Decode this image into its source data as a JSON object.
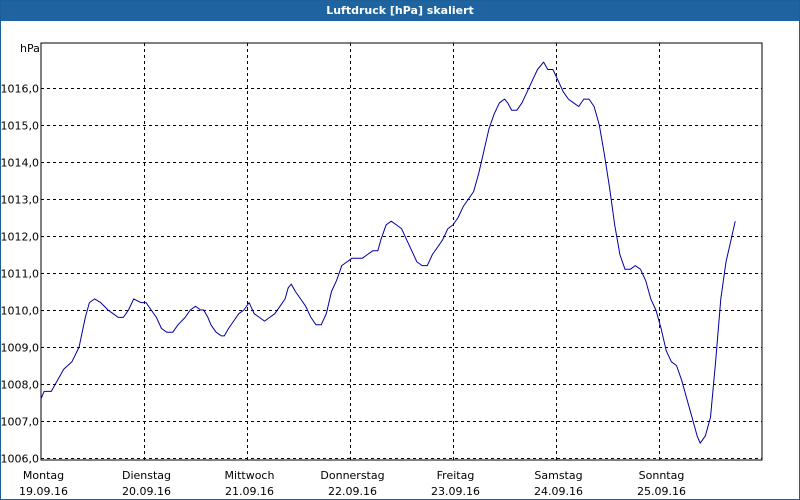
{
  "window": {
    "title": "Luftdruck [hPa] skaliert"
  },
  "chart_data": {
    "type": "line",
    "title": "Luftdruck [hPa] skaliert",
    "ylabel": "hPa",
    "xlabel": "",
    "ylim": [
      1005.9,
      1017.3
    ],
    "yticks": [
      1006.0,
      1007.0,
      1008.0,
      1009.0,
      1010.0,
      1011.0,
      1012.0,
      1013.0,
      1014.0,
      1015.0,
      1016.0
    ],
    "ytick_labels": [
      "1006,0",
      "1007,0",
      "1008,0",
      "1009,0",
      "1010,0",
      "1011,0",
      "1012,0",
      "1013,0",
      "1014,0",
      "1015,0",
      "1016,0"
    ],
    "x_range_days": [
      0,
      7
    ],
    "xticks": [
      {
        "day": 0,
        "weekday": "Montag",
        "date": "19.09.16"
      },
      {
        "day": 1,
        "weekday": "Dienstag",
        "date": "20.09.16"
      },
      {
        "day": 2,
        "weekday": "Mittwoch",
        "date": "21.09.16"
      },
      {
        "day": 3,
        "weekday": "Donnerstag",
        "date": "22.09.16"
      },
      {
        "day": 4,
        "weekday": "Freitag",
        "date": "23.09.16"
      },
      {
        "day": 5,
        "weekday": "Samstag",
        "date": "24.09.16"
      },
      {
        "day": 6,
        "weekday": "Sonntag",
        "date": "25.09.16"
      }
    ],
    "grid": true,
    "series_color": "#0000a0",
    "series": [
      {
        "values": [
          [
            0.0,
            1007.6
          ],
          [
            0.03,
            1007.8
          ],
          [
            0.1,
            1007.8
          ],
          [
            0.16,
            1008.1
          ],
          [
            0.22,
            1008.4
          ],
          [
            0.3,
            1008.6
          ],
          [
            0.37,
            1009.0
          ],
          [
            0.43,
            1009.8
          ],
          [
            0.47,
            1010.2
          ],
          [
            0.52,
            1010.3
          ],
          [
            0.58,
            1010.2
          ],
          [
            0.65,
            1010.0
          ],
          [
            0.7,
            1009.9
          ],
          [
            0.75,
            1009.8
          ],
          [
            0.8,
            1009.8
          ],
          [
            0.85,
            1010.0
          ],
          [
            0.9,
            1010.3
          ],
          [
            0.97,
            1010.2
          ],
          [
            1.02,
            1010.2
          ],
          [
            1.07,
            1010.0
          ],
          [
            1.12,
            1009.8
          ],
          [
            1.17,
            1009.5
          ],
          [
            1.22,
            1009.4
          ],
          [
            1.28,
            1009.4
          ],
          [
            1.33,
            1009.6
          ],
          [
            1.4,
            1009.8
          ],
          [
            1.45,
            1010.0
          ],
          [
            1.5,
            1010.1
          ],
          [
            1.55,
            1010.0
          ],
          [
            1.58,
            1010.0
          ],
          [
            1.62,
            1009.8
          ],
          [
            1.65,
            1009.6
          ],
          [
            1.7,
            1009.4
          ],
          [
            1.75,
            1009.3
          ],
          [
            1.78,
            1009.3
          ],
          [
            1.82,
            1009.5
          ],
          [
            1.87,
            1009.7
          ],
          [
            1.92,
            1009.9
          ],
          [
            1.97,
            1010.0
          ],
          [
            2.02,
            1010.2
          ],
          [
            2.07,
            1009.9
          ],
          [
            2.12,
            1009.8
          ],
          [
            2.17,
            1009.7
          ],
          [
            2.22,
            1009.8
          ],
          [
            2.27,
            1009.9
          ],
          [
            2.32,
            1010.1
          ],
          [
            2.37,
            1010.3
          ],
          [
            2.4,
            1010.6
          ],
          [
            2.43,
            1010.7
          ],
          [
            2.47,
            1010.5
          ],
          [
            2.52,
            1010.3
          ],
          [
            2.57,
            1010.1
          ],
          [
            2.62,
            1009.8
          ],
          [
            2.67,
            1009.6
          ],
          [
            2.72,
            1009.6
          ],
          [
            2.77,
            1009.9
          ],
          [
            2.82,
            1010.5
          ],
          [
            2.87,
            1010.8
          ],
          [
            2.92,
            1011.2
          ],
          [
            2.97,
            1011.3
          ],
          [
            3.02,
            1011.4
          ],
          [
            3.07,
            1011.4
          ],
          [
            3.12,
            1011.4
          ],
          [
            3.17,
            1011.5
          ],
          [
            3.22,
            1011.6
          ],
          [
            3.27,
            1011.6
          ],
          [
            3.3,
            1011.9
          ],
          [
            3.35,
            1012.3
          ],
          [
            3.4,
            1012.4
          ],
          [
            3.45,
            1012.3
          ],
          [
            3.5,
            1012.2
          ],
          [
            3.55,
            1011.9
          ],
          [
            3.6,
            1011.6
          ],
          [
            3.65,
            1011.3
          ],
          [
            3.7,
            1011.2
          ],
          [
            3.75,
            1011.2
          ],
          [
            3.8,
            1011.5
          ],
          [
            3.85,
            1011.7
          ],
          [
            3.9,
            1011.9
          ],
          [
            3.95,
            1012.2
          ],
          [
            4.0,
            1012.3
          ],
          [
            4.05,
            1012.5
          ],
          [
            4.1,
            1012.8
          ],
          [
            4.15,
            1013.0
          ],
          [
            4.2,
            1013.2
          ],
          [
            4.25,
            1013.7
          ],
          [
            4.3,
            1014.3
          ],
          [
            4.35,
            1014.9
          ],
          [
            4.4,
            1015.3
          ],
          [
            4.45,
            1015.6
          ],
          [
            4.5,
            1015.7
          ],
          [
            4.53,
            1015.6
          ],
          [
            4.57,
            1015.4
          ],
          [
            4.62,
            1015.4
          ],
          [
            4.67,
            1015.6
          ],
          [
            4.72,
            1015.9
          ],
          [
            4.77,
            1016.2
          ],
          [
            4.82,
            1016.5
          ],
          [
            4.88,
            1016.7
          ],
          [
            4.92,
            1016.5
          ],
          [
            4.97,
            1016.5
          ],
          [
            5.02,
            1016.2
          ],
          [
            5.07,
            1015.9
          ],
          [
            5.12,
            1015.7
          ],
          [
            5.17,
            1015.6
          ],
          [
            5.22,
            1015.5
          ],
          [
            5.27,
            1015.7
          ],
          [
            5.32,
            1015.7
          ],
          [
            5.37,
            1015.5
          ],
          [
            5.42,
            1015.0
          ],
          [
            5.47,
            1014.2
          ],
          [
            5.52,
            1013.3
          ],
          [
            5.57,
            1012.3
          ],
          [
            5.62,
            1011.5
          ],
          [
            5.67,
            1011.1
          ],
          [
            5.72,
            1011.1
          ],
          [
            5.77,
            1011.2
          ],
          [
            5.82,
            1011.1
          ],
          [
            5.87,
            1010.8
          ],
          [
            5.92,
            1010.3
          ],
          [
            5.97,
            1010.0
          ],
          [
            6.02,
            1009.5
          ],
          [
            6.07,
            1008.9
          ],
          [
            6.12,
            1008.6
          ],
          [
            6.17,
            1008.5
          ],
          [
            6.22,
            1008.1
          ],
          [
            6.27,
            1007.6
          ],
          [
            6.32,
            1007.1
          ],
          [
            6.37,
            1006.6
          ],
          [
            6.4,
            1006.4
          ],
          [
            6.45,
            1006.6
          ],
          [
            6.5,
            1007.1
          ],
          [
            6.55,
            1008.6
          ],
          [
            6.6,
            1010.3
          ],
          [
            6.65,
            1011.3
          ],
          [
            6.7,
            1011.9
          ],
          [
            6.74,
            1012.4
          ]
        ]
      }
    ]
  }
}
